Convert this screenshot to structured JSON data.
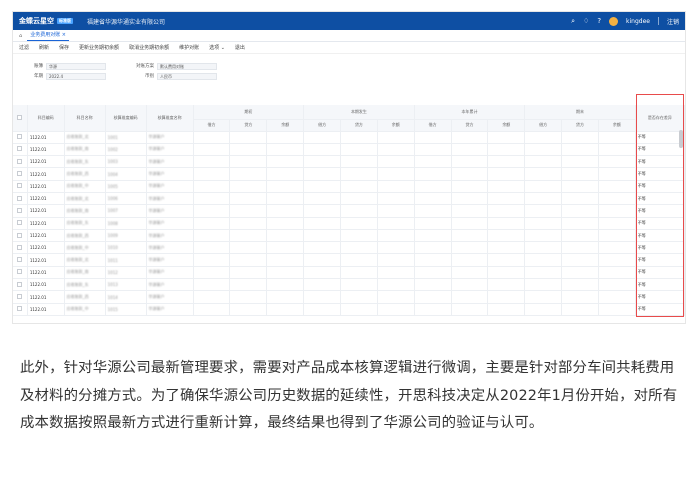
{
  "app": {
    "brand": "金蝶云星空",
    "brand_badge": "标准版",
    "org": "福建省华源华通实业有限公司",
    "user": "kingdee",
    "logout": "注销"
  },
  "tabs": {
    "home": "⌂",
    "active": "业务费用对账"
  },
  "toolbar": [
    "过滤",
    "刷新",
    "保存",
    "更新业务期初余额",
    "取消业务期初余额",
    "维护对账",
    "选项",
    "退出"
  ],
  "filters": {
    "org_label": "账簿",
    "org_value": "华源",
    "year_label": "年期",
    "year_value": "2022.4",
    "type_label": "对账方案",
    "type_value": "默认费用对账",
    "currency_label": "币别",
    "currency_value": "人民币"
  },
  "grid": {
    "head_top": [
      "",
      "科目编码",
      "科目名称",
      "核算维度编码",
      "核算维度名称",
      "期初",
      "本期发生",
      "本年累计",
      "期末",
      "是否存在差异"
    ],
    "head_sub": [
      "借方",
      "贷方",
      "余额",
      "借方",
      "贷方",
      "余额",
      "借方",
      "贷方",
      "余额",
      "借方",
      "贷方",
      "余额"
    ],
    "rows": [
      {
        "code": "1122.01",
        "name": "应收账款_北",
        "dim_code": "1001",
        "dim_name": "华源客户",
        "diff": "不等"
      },
      {
        "code": "1122.01",
        "name": "应收账款_南",
        "dim_code": "1002",
        "dim_name": "华源客户",
        "diff": "不等"
      },
      {
        "code": "1122.01",
        "name": "应收账款_东",
        "dim_code": "1003",
        "dim_name": "华源客户",
        "diff": "不等"
      },
      {
        "code": "1122.01",
        "name": "应收账款_西",
        "dim_code": "1004",
        "dim_name": "华源客户",
        "diff": "不等"
      },
      {
        "code": "1122.01",
        "name": "应收账款_中",
        "dim_code": "1005",
        "dim_name": "华源客户",
        "diff": "不等"
      },
      {
        "code": "1122.01",
        "name": "应收账款_北",
        "dim_code": "1006",
        "dim_name": "华源客户",
        "diff": "不等"
      },
      {
        "code": "1122.01",
        "name": "应收账款_南",
        "dim_code": "1007",
        "dim_name": "华源客户",
        "diff": "不等"
      },
      {
        "code": "1122.01",
        "name": "应收账款_东",
        "dim_code": "1008",
        "dim_name": "华源客户",
        "diff": "不等"
      },
      {
        "code": "1122.01",
        "name": "应收账款_西",
        "dim_code": "1009",
        "dim_name": "华源客户",
        "diff": "不等"
      },
      {
        "code": "1122.01",
        "name": "应收账款_中",
        "dim_code": "1010",
        "dim_name": "华源客户",
        "diff": "不等"
      },
      {
        "code": "1122.01",
        "name": "应收账款_北",
        "dim_code": "1011",
        "dim_name": "华源客户",
        "diff": "不等"
      },
      {
        "code": "1122.01",
        "name": "应收账款_南",
        "dim_code": "1012",
        "dim_name": "华源客户",
        "diff": "不等"
      },
      {
        "code": "1122.01",
        "name": "应收账款_东",
        "dim_code": "1013",
        "dim_name": "华源客户",
        "diff": "不等"
      },
      {
        "code": "1122.01",
        "name": "应收账款_西",
        "dim_code": "1014",
        "dim_name": "华源客户",
        "diff": "不等"
      },
      {
        "code": "1122.01",
        "name": "应收账款_中",
        "dim_code": "1015",
        "dim_name": "华源客户",
        "diff": "不等"
      }
    ]
  },
  "paragraph": "此外，针对华源公司最新管理要求，需要对产品成本核算逻辑进行微调，主要是针对部分车间共耗费用及材料的分摊方式。为了确保华源公司历史数据的延续性，开思科技决定从2022年1月份开始，对所有成本数据按照最新方式进行重新计算，最终结果也得到了华源公司的验证与认可。"
}
